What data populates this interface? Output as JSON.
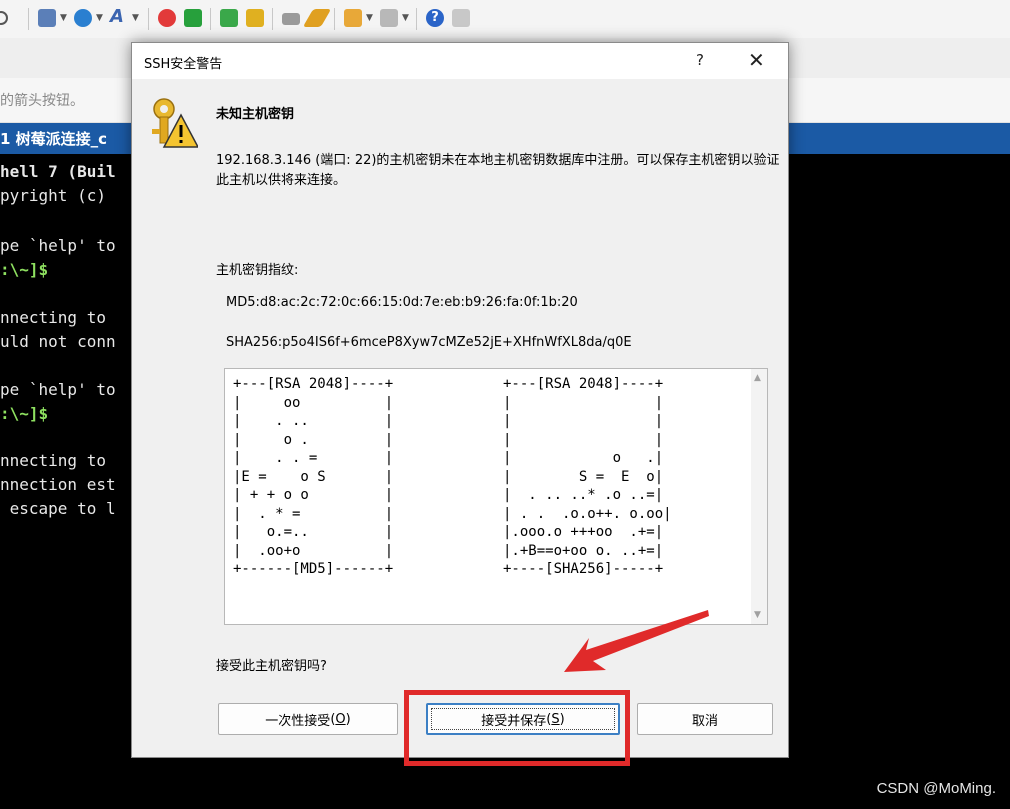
{
  "toolbar": {
    "icons": [
      "search-icon",
      "new-session-icon",
      "globe-icon",
      "font-icon",
      "swirl-icon",
      "green-terminal-icon",
      "fullscreen-icon",
      "lock-icon",
      "keyboard-icon",
      "pencil-icon",
      "add-folder-icon",
      "layout-icon",
      "help-icon",
      "chat-icon"
    ]
  },
  "background": {
    "hint_text": "的箭头按钮。",
    "tab_label": "1 树莓派连接_c",
    "terminal_lines": [
      "hell 7 (Buil",
      "pyright (c)",
      "",
      "pe `help' to",
      ":\\~]$",
      "",
      "nnecting to",
      "uld not conn",
      "",
      "pe `help' to",
      ":\\~]$",
      "",
      "nnecting to",
      "nnection est",
      " escape to l"
    ],
    "watermark": "CSDN @MoMing."
  },
  "dialog": {
    "title": "SSH安全警告",
    "help_label": "?",
    "close_label": "✕",
    "heading": "未知主机密钥",
    "message": "192.168.3.146 (端口: 22)的主机密钥未在本地主机密钥数据库中注册。可以保存主机密钥以验证此主机以供将来连接。",
    "fingerprint_label": "主机密钥指纹:",
    "md5": "MD5:d8:ac:2c:72:0c:66:15:0d:7e:eb:b9:26:fa:0f:1b:20",
    "sha256": "SHA256:p5o4IS6f+6mceP8Xyw7cMZe52jE+XHfnWfXL8da/q0E",
    "randomart_md5": "+---[RSA 2048]----+\n|     oo          |\n|    . ..         |\n|     o .         |\n|    . . =        |\n|E =    o S       |\n| + + o o         |\n|  . * =          |\n|   o.=..         |\n|  .oo+o          |\n+------[MD5]------+",
    "randomart_sha256": "+---[RSA 2048]----+\n|                 |\n|                 |\n|                 |\n|            o   .|\n|        S =  E  o|\n|  . .. ..* .o ..=|\n| . .  .o.o++. o.oo|\n|.ooo.o +++oo  .+=|\n|.+B==o+oo o. ..+=|\n+----[SHA256]-----+",
    "question": "接受此主机密钥吗?",
    "buttons": {
      "accept_once_text": "一次性接受",
      "accept_once_key": "O",
      "accept_save_text": "接受并保存",
      "accept_save_key": "S",
      "cancel": "取消"
    }
  },
  "colors": {
    "tab_blue": "#1b5aa5",
    "highlight_red": "#e02a2a",
    "focus_blue": "#3c7fc4"
  }
}
